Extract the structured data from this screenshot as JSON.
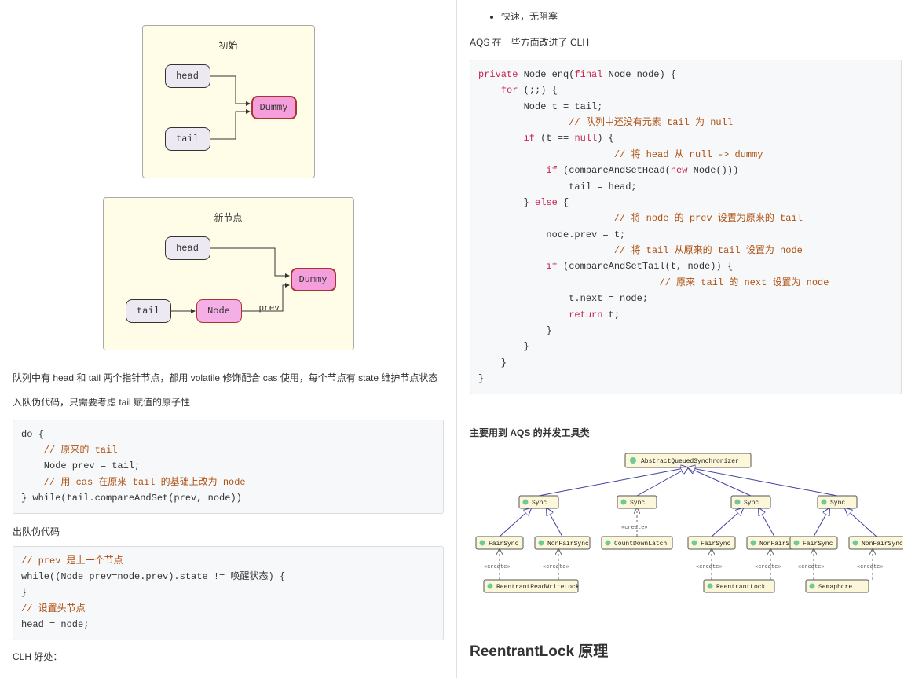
{
  "left": {
    "diagram1": {
      "title": "初始",
      "head": "head",
      "tail": "tail",
      "dummy": "Dummy"
    },
    "diagram2": {
      "title": "新节点",
      "head": "head",
      "tail": "tail",
      "node": "Node",
      "dummy": "Dummy",
      "prev": "prev"
    },
    "para1": "队列中有 head 和 tail 两个指针节点，都用 volatile 修饰配合 cas 使用，每个节点有 state 维护节点状态",
    "para2": "入队伪代码，只需要考虑 tail 赋值的原子性",
    "code1": {
      "l1": "do {",
      "l2": "    // 原来的 tail",
      "l3": "    Node prev = tail;",
      "l4": "    // 用 cas 在原来 tail 的基础上改为 node",
      "l5": "} while(tail.compareAndSet(prev, node))"
    },
    "label_dequeue": "出队伪代码",
    "code2": {
      "l1": "// prev 是上一个节点",
      "l2": "while((Node prev=node.prev).state != 唤醒状态) {",
      "l3": "}",
      "l4": "// 设置头节点",
      "l5": "head = node;"
    },
    "clh_label": "CLH 好处："
  },
  "right": {
    "bullet1": "快速，无阻塞",
    "improve": "AQS 在一些方面改进了 CLH",
    "code": {
      "l1": "private Node enq(final Node node) {",
      "l2": "    for (;;) {",
      "l3": "        Node t = tail;",
      "l4": "        // 队列中还没有元素 tail 为 null",
      "l5": "        if (t == null) {",
      "l6": "            // 将 head 从 null -> dummy",
      "l7": "            if (compareAndSetHead(new Node()))",
      "l8": "                tail = head;",
      "l9": "        } else {",
      "l10": "            // 将 node 的 prev 设置为原来的 tail",
      "l11": "            node.prev = t;",
      "l12": "            // 将 tail 从原来的 tail 设置为 node",
      "l13": "            if (compareAndSetTail(t, node)) {",
      "l14": "                // 原来 tail 的 next 设置为 node",
      "l15": "                t.next = node;",
      "l16": "                return t;",
      "l17": "            }",
      "l18": "        }",
      "l19": "    }",
      "l20": "}"
    },
    "tools_heading": "主要用到 AQS 的并发工具类",
    "uml": {
      "root": "AbstractQueuedSynchronizer",
      "sync": "Sync",
      "fair": "FairSync",
      "nonfair": "NonFairSync",
      "cdl": "CountDownLatch",
      "rrwl": "ReentrantReadWriteLock",
      "rl": "ReentrantLock",
      "sem": "Semaphore",
      "create": "«create»"
    },
    "reentrant_heading": "ReentrantLock 原理"
  }
}
